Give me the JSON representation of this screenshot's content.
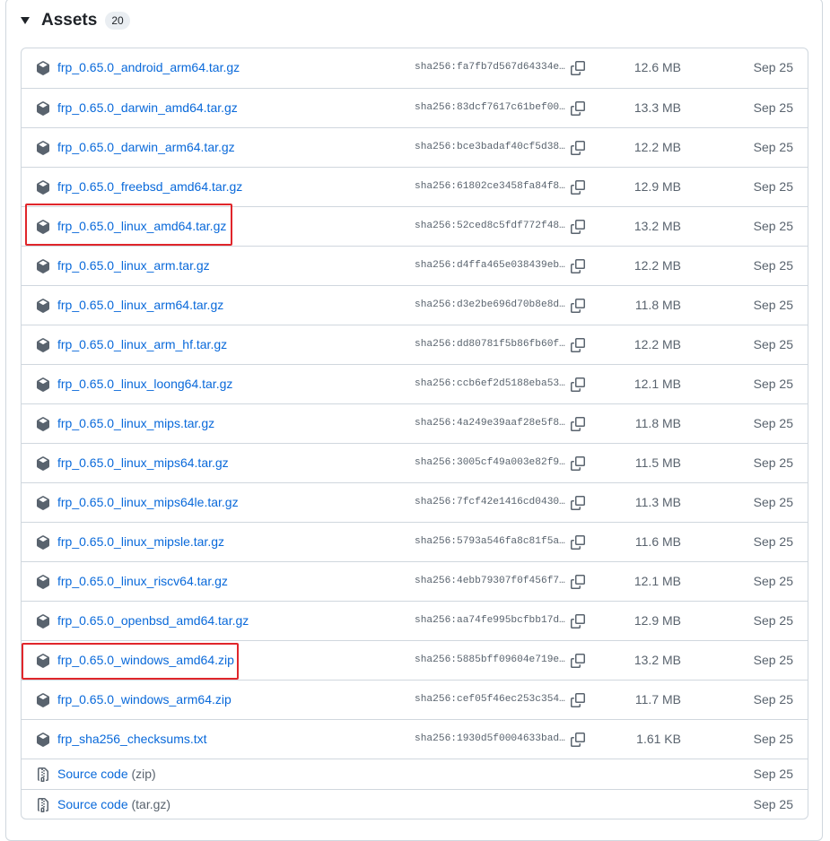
{
  "header": {
    "title": "Assets",
    "count": "20"
  },
  "assets": [
    {
      "name": "frp_0.65.0_android_arm64.tar.gz",
      "sha": "sha256:fa7fb7d567d64334e…",
      "size": "12.6 MB",
      "date": "Sep 25"
    },
    {
      "name": "frp_0.65.0_darwin_amd64.tar.gz",
      "sha": "sha256:83dcf7617c61bef00…",
      "size": "13.3 MB",
      "date": "Sep 25"
    },
    {
      "name": "frp_0.65.0_darwin_arm64.tar.gz",
      "sha": "sha256:bce3badaf40cf5d38…",
      "size": "12.2 MB",
      "date": "Sep 25"
    },
    {
      "name": "frp_0.65.0_freebsd_amd64.tar.gz",
      "sha": "sha256:61802ce3458fa84f8…",
      "size": "12.9 MB",
      "date": "Sep 25"
    },
    {
      "name": "frp_0.65.0_linux_amd64.tar.gz",
      "sha": "sha256:52ced8c5fdf772f48…",
      "size": "13.2 MB",
      "date": "Sep 25"
    },
    {
      "name": "frp_0.65.0_linux_arm.tar.gz",
      "sha": "sha256:d4ffa465e038439eb…",
      "size": "12.2 MB",
      "date": "Sep 25"
    },
    {
      "name": "frp_0.65.0_linux_arm64.tar.gz",
      "sha": "sha256:d3e2be696d70b8e8d…",
      "size": "11.8 MB",
      "date": "Sep 25"
    },
    {
      "name": "frp_0.65.0_linux_arm_hf.tar.gz",
      "sha": "sha256:dd80781f5b86fb60f…",
      "size": "12.2 MB",
      "date": "Sep 25"
    },
    {
      "name": "frp_0.65.0_linux_loong64.tar.gz",
      "sha": "sha256:ccb6ef2d5188eba53…",
      "size": "12.1 MB",
      "date": "Sep 25"
    },
    {
      "name": "frp_0.65.0_linux_mips.tar.gz",
      "sha": "sha256:4a249e39aaf28e5f8…",
      "size": "11.8 MB",
      "date": "Sep 25"
    },
    {
      "name": "frp_0.65.0_linux_mips64.tar.gz",
      "sha": "sha256:3005cf49a003e82f9…",
      "size": "11.5 MB",
      "date": "Sep 25"
    },
    {
      "name": "frp_0.65.0_linux_mips64le.tar.gz",
      "sha": "sha256:7fcf42e1416cd0430…",
      "size": "11.3 MB",
      "date": "Sep 25"
    },
    {
      "name": "frp_0.65.0_linux_mipsle.tar.gz",
      "sha": "sha256:5793a546fa8c81f5a…",
      "size": "11.6 MB",
      "date": "Sep 25"
    },
    {
      "name": "frp_0.65.0_linux_riscv64.tar.gz",
      "sha": "sha256:4ebb79307f0f456f7…",
      "size": "12.1 MB",
      "date": "Sep 25"
    },
    {
      "name": "frp_0.65.0_openbsd_amd64.tar.gz",
      "sha": "sha256:aa74fe995bcfbb17d…",
      "size": "12.9 MB",
      "date": "Sep 25"
    },
    {
      "name": "frp_0.65.0_windows_amd64.zip",
      "sha": "sha256:5885bff09604e719e…",
      "size": "13.2 MB",
      "date": "Sep 25"
    },
    {
      "name": "frp_0.65.0_windows_arm64.zip",
      "sha": "sha256:cef05f46ec253c354…",
      "size": "11.7 MB",
      "date": "Sep 25"
    },
    {
      "name": "frp_sha256_checksums.txt",
      "sha": "sha256:1930d5f0004633bad…",
      "size": "1.61 KB",
      "date": "Sep 25"
    }
  ],
  "source": [
    {
      "label": "Source code",
      "format": "(zip)",
      "date": "Sep 25"
    },
    {
      "label": "Source code",
      "format": "(tar.gz)",
      "date": "Sep 25"
    }
  ],
  "highlighted_rows": [
    "frp_0.65.0_linux_amd64.tar.gz",
    "frp_0.65.0_windows_amd64.zip"
  ],
  "colors": {
    "link": "#0969da",
    "muted": "#59636e",
    "border": "#d0d7de",
    "highlight": "#e0262b"
  },
  "icons": {
    "asset": "package-icon",
    "copy": "copy-icon",
    "source": "file-zip-icon",
    "toggle": "triangle-down-icon"
  }
}
